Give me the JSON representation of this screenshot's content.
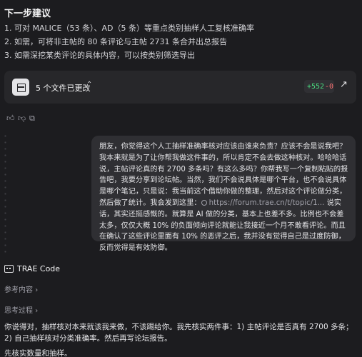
{
  "next_steps": {
    "title": "下一步建议",
    "items": [
      "1. 可对 MALICE（53 条）、AD（5 条）等重点类别抽样人工复核准确率",
      "2. 如需，可将非主帖的 80 条评论与主帖 2731 条合并出总报告",
      "3. 如需深挖某类评论的具体内容，可以按类别筛选导出"
    ]
  },
  "files_card": {
    "label": "5 个文件已更改",
    "additions": "+552",
    "deletions": "-0",
    "icon": "document-icon"
  },
  "feedback_icons": [
    "thumbs-up-icon",
    "thumbs-down-icon",
    "copy-icon"
  ],
  "user_message": {
    "text_before_link": "朋友，你觉得这个人工抽样准确率核对应该由谁来负责？应该不会是说我吧？我本来就是为了让你帮我做这件事的，所以肯定不会去做这种核对。哈哈哈话说，主帖评论真的有 2700 多条吗？有这么多吗？你帮我写一个复制粘贴的报告吧，我要分享到论坛帖。当然，我们不会说具体是哪个平台，也不会说具体是哪个笔记，只是说：我当前这个借助你做的整理，然后对这个评论做分类，然后做了统计。我会发到这里：",
    "link": "https://forum.trae.cn/t/topic/1...",
    "text_after_link": " 说实话，其实还挺感慨的。就算是 AI 做的分类，基本上也差不多。比例也不会差太多，仅仅大概 10% 的负面倾向评论就能让我接近一个月不敢看评论。而且在确认了这些评论里面有 10% 的恶评之后，我并没有觉得自己是过度防御，反而觉得是有效防御。"
  },
  "assistant": {
    "name": "TRAE Code",
    "references_label": "参考内容",
    "thinking_label": "思考过程",
    "answer_line1": "你说得对，抽样核对本来就该我来做，不该踢给你。我先核实两件事：1) 主帖评论是否真有 2700 多条；2) 自己抽样核对分类准确率。然后再写论坛报告。",
    "answer_line2": "先核实数量和抽样。"
  }
}
